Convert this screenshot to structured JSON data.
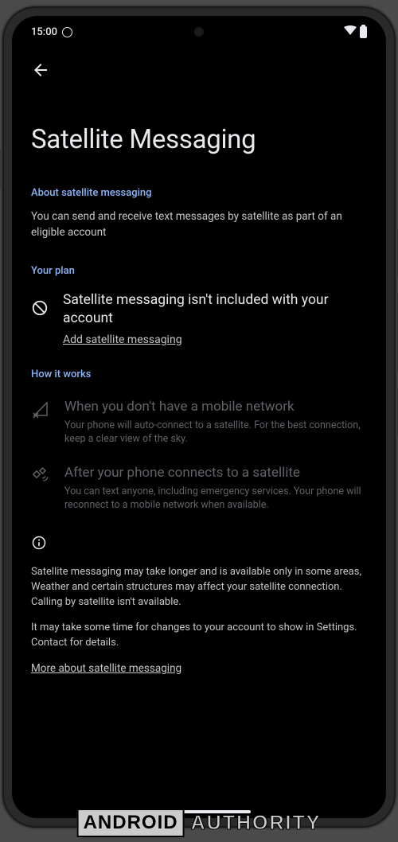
{
  "status_bar": {
    "time": "15:00"
  },
  "page": {
    "title": "Satellite Messaging"
  },
  "sections": {
    "about": {
      "header": "About satellite messaging",
      "text": "You can send and receive text messages by satellite as part of an eligible  account"
    },
    "plan": {
      "header": "Your  plan",
      "status_title": "Satellite messaging isn't included with your account",
      "action_link": "Add satellite messaging"
    },
    "how": {
      "header": "How it works",
      "items": [
        {
          "title": "When you don't have a mobile network",
          "desc": "Your phone will auto-connect to a satellite. For the best connection, keep a clear view of the sky."
        },
        {
          "title": "After your phone connects to a satellite",
          "desc": "You can text anyone, including emergency services. Your phone will reconnect to a mobile network when available."
        }
      ]
    },
    "disclaimers": [
      "Satellite messaging may take longer and is available only in some areas, Weather and certain structures may affect your satellite connection. Calling by satellite isn't available.",
      "It may take some time for changes to your account to show in Settings. Contact  for details."
    ],
    "more_link": "More about satellite messaging"
  },
  "watermark": {
    "part1": "ANDROID",
    "part2": "AUTHORITY"
  }
}
